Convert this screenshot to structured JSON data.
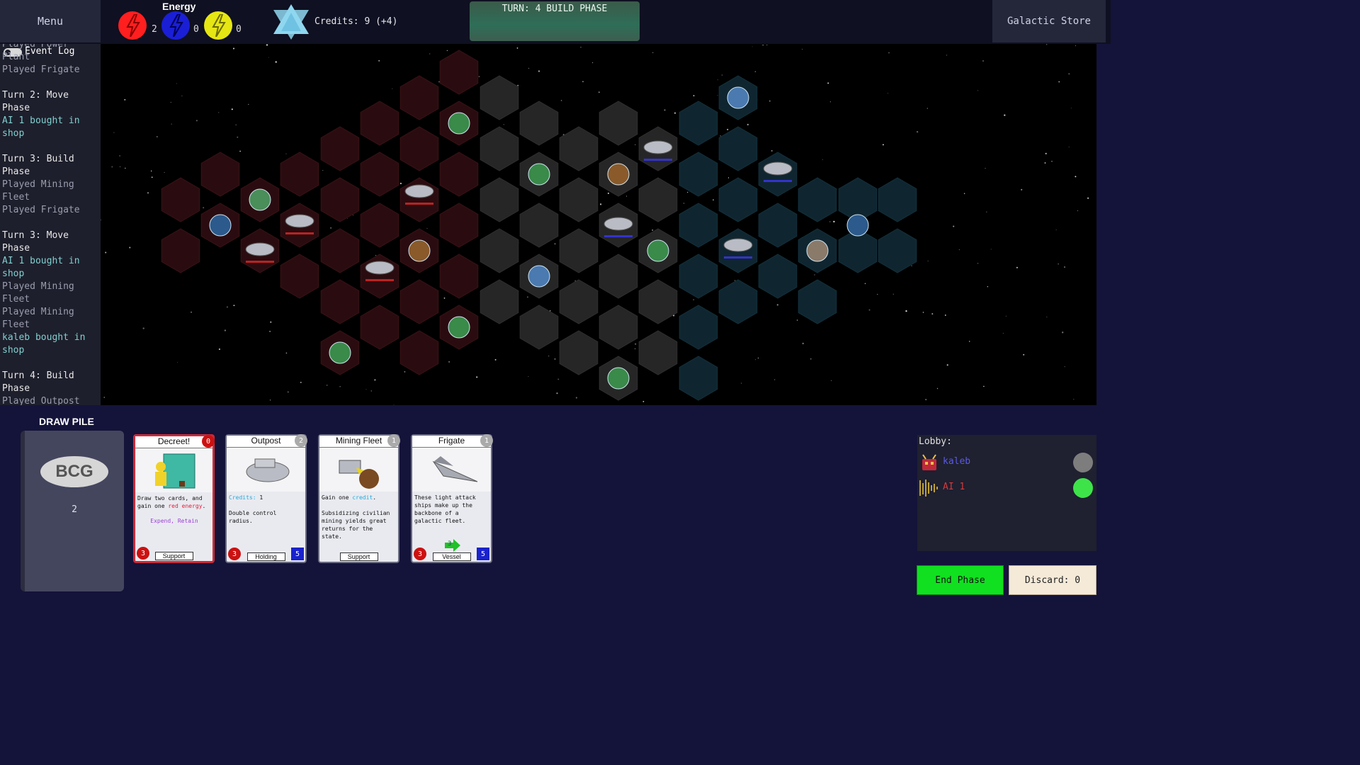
{
  "topbar": {
    "menu_label": "Menu",
    "energy_title": "Energy",
    "energy": [
      {
        "name": "red-energy",
        "count": "2",
        "color": "#ff1f1f"
      },
      {
        "name": "blue-energy",
        "count": "0",
        "color": "#1a1fd6"
      },
      {
        "name": "yellow-energy",
        "count": "0",
        "color": "#e6e614"
      }
    ],
    "credits_label": "Credits: 9 (+4)",
    "turn_label": "TURN: 4 BUILD PHASE",
    "store_label": "Galactic Store"
  },
  "event_log": {
    "title": "Event Log",
    "entries": [
      {
        "text": "Played Power Plant",
        "kind": "played"
      },
      {
        "text": "Played Frigate",
        "kind": "played"
      },
      {
        "text": "Turn 2: Move Phase",
        "kind": "head"
      },
      {
        "text": "AI 1 bought in shop",
        "kind": "shop"
      },
      {
        "text": "Turn 3: Build Phase",
        "kind": "head"
      },
      {
        "text": "Played Mining Fleet",
        "kind": "played"
      },
      {
        "text": "Played Frigate",
        "kind": "played"
      },
      {
        "text": "Turn 3: Move Phase",
        "kind": "head"
      },
      {
        "text": "AI 1 bought in shop",
        "kind": "shop"
      },
      {
        "text": "Played Mining Fleet",
        "kind": "played"
      },
      {
        "text": "Played Mining Fleet",
        "kind": "played"
      },
      {
        "text": "kaleb bought in shop",
        "kind": "shop"
      },
      {
        "text": "Turn 4: Build Phase",
        "kind": "head"
      },
      {
        "text": "Played Outpost",
        "kind": "played"
      }
    ]
  },
  "draw_pile": {
    "title": "DRAW PILE",
    "logo": "BCG",
    "count": "2"
  },
  "hand": [
    {
      "title": "Decreet!",
      "cost": "0",
      "cost_color": "#cc1111",
      "border": "red",
      "text": [
        {
          "t": "Draw two cards, and gain one "
        },
        {
          "t": "red energy",
          "c": "#e0203a"
        },
        {
          "t": "."
        }
      ],
      "keywords": "Expend, Retain",
      "type": "Support",
      "attack": "3",
      "health": "",
      "art": "decree"
    },
    {
      "title": "Outpost",
      "cost": "2",
      "cost_color": "#aaaaaa",
      "border": "grey",
      "text": [
        {
          "t": "Credits:",
          "c": "#22aadd"
        },
        {
          "t": " 1\n\nDouble control radius."
        }
      ],
      "keywords": "",
      "type": "Holding",
      "attack": "3",
      "health": "5",
      "art": "outpost"
    },
    {
      "title": "Mining Fleet",
      "cost": "1",
      "cost_color": "#aaaaaa",
      "border": "grey",
      "text": [
        {
          "t": "Gain one "
        },
        {
          "t": "credit",
          "c": "#22aadd"
        },
        {
          "t": ".\n\nSubsidizing civilian mining yields great returns for the state."
        }
      ],
      "keywords": "",
      "type": "Support",
      "attack": "",
      "health": "",
      "art": "mining"
    },
    {
      "title": "Frigate",
      "cost": "1",
      "cost_color": "#aaaaaa",
      "border": "grey",
      "text": [
        {
          "t": "These light attack ships make up the backbone of a galactic fleet."
        }
      ],
      "keywords": "",
      "type": "Vessel",
      "attack": "3",
      "health": "5",
      "art": "frigate",
      "move": "3"
    }
  ],
  "lobby": {
    "title": "Lobby:",
    "players": [
      {
        "name": "kaleb",
        "color": "#5a5ae0",
        "ready_color": "#7d7d7d",
        "icon": "robot-icon"
      },
      {
        "name": "AI 1",
        "color": "#d43a3a",
        "ready_color": "#3ee34a",
        "icon": "barcode-icon"
      }
    ]
  },
  "controls": {
    "end_phase": "End Phase",
    "discard": "Discard: 0"
  }
}
